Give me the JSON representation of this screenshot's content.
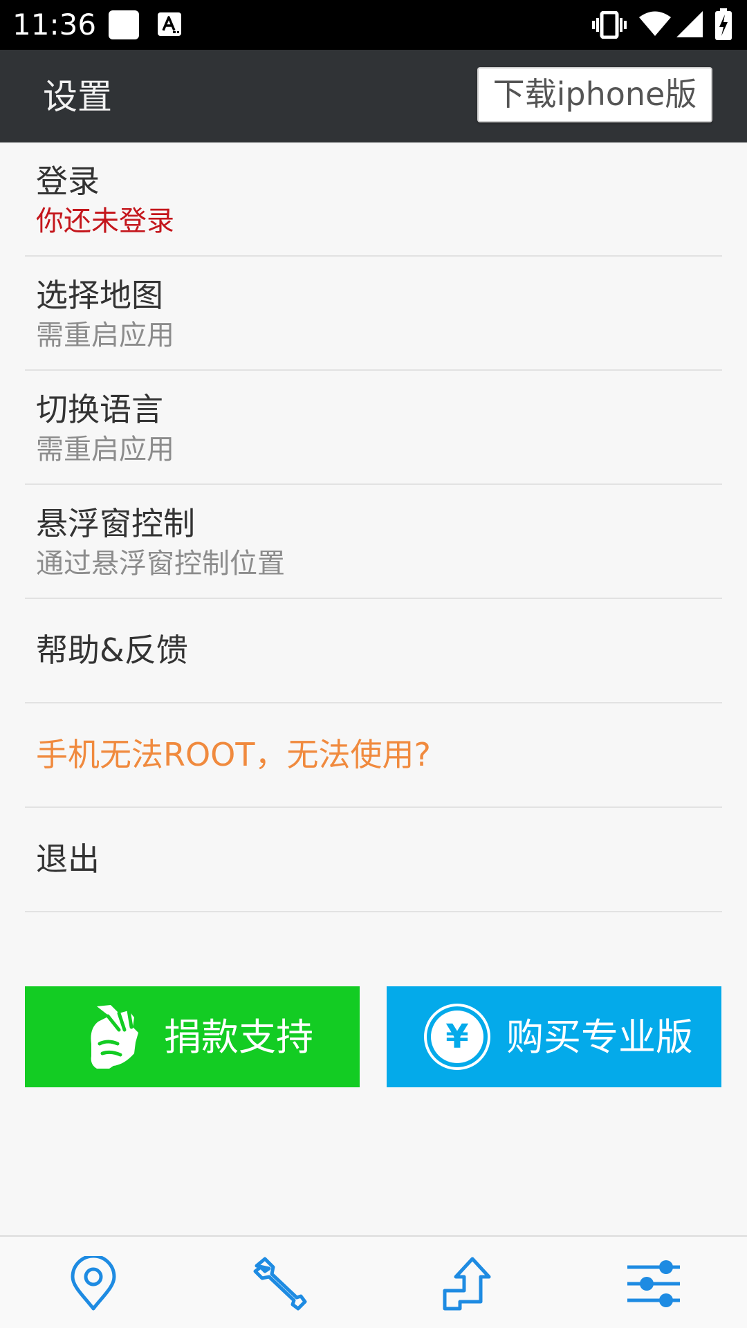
{
  "status_bar": {
    "time": "11:36",
    "icons": [
      "notification-square-icon",
      "font-a-icon",
      "vibrate-icon",
      "wifi-icon",
      "signal-icon",
      "battery-charging-icon"
    ]
  },
  "header": {
    "title": "设置",
    "download_button_label": "下载iphone版"
  },
  "settings": {
    "login": {
      "title": "登录",
      "subtitle": "你还未登录"
    },
    "select_map": {
      "title": "选择地图",
      "subtitle": "需重启应用"
    },
    "switch_language": {
      "title": "切换语言",
      "subtitle": "需重启应用"
    },
    "floating_window": {
      "title": "悬浮窗控制",
      "subtitle": "通过悬浮窗控制位置"
    },
    "help_feedback": {
      "title": "帮助&反馈"
    },
    "no_root": {
      "title": "手机无法ROOT，无法使用?"
    },
    "exit": {
      "title": "退出"
    }
  },
  "actions": {
    "donate_label": "捐款支持",
    "pro_label": "购买专业版",
    "pro_icon_symbol": "¥"
  },
  "bottom_nav": {
    "items": [
      "location-pin-icon",
      "wrench-icon",
      "route-arrow-icon",
      "settings-sliders-icon"
    ],
    "active": "settings-sliders-icon"
  },
  "colors": {
    "app_bar": "#303336",
    "background": "#f7f7f7",
    "login_status_red": "#c4161c",
    "no_root_orange": "#f08a3e",
    "donate_green": "#13cc23",
    "pro_blue": "#04aaea",
    "nav_icon_blue": "#1e8be2"
  }
}
